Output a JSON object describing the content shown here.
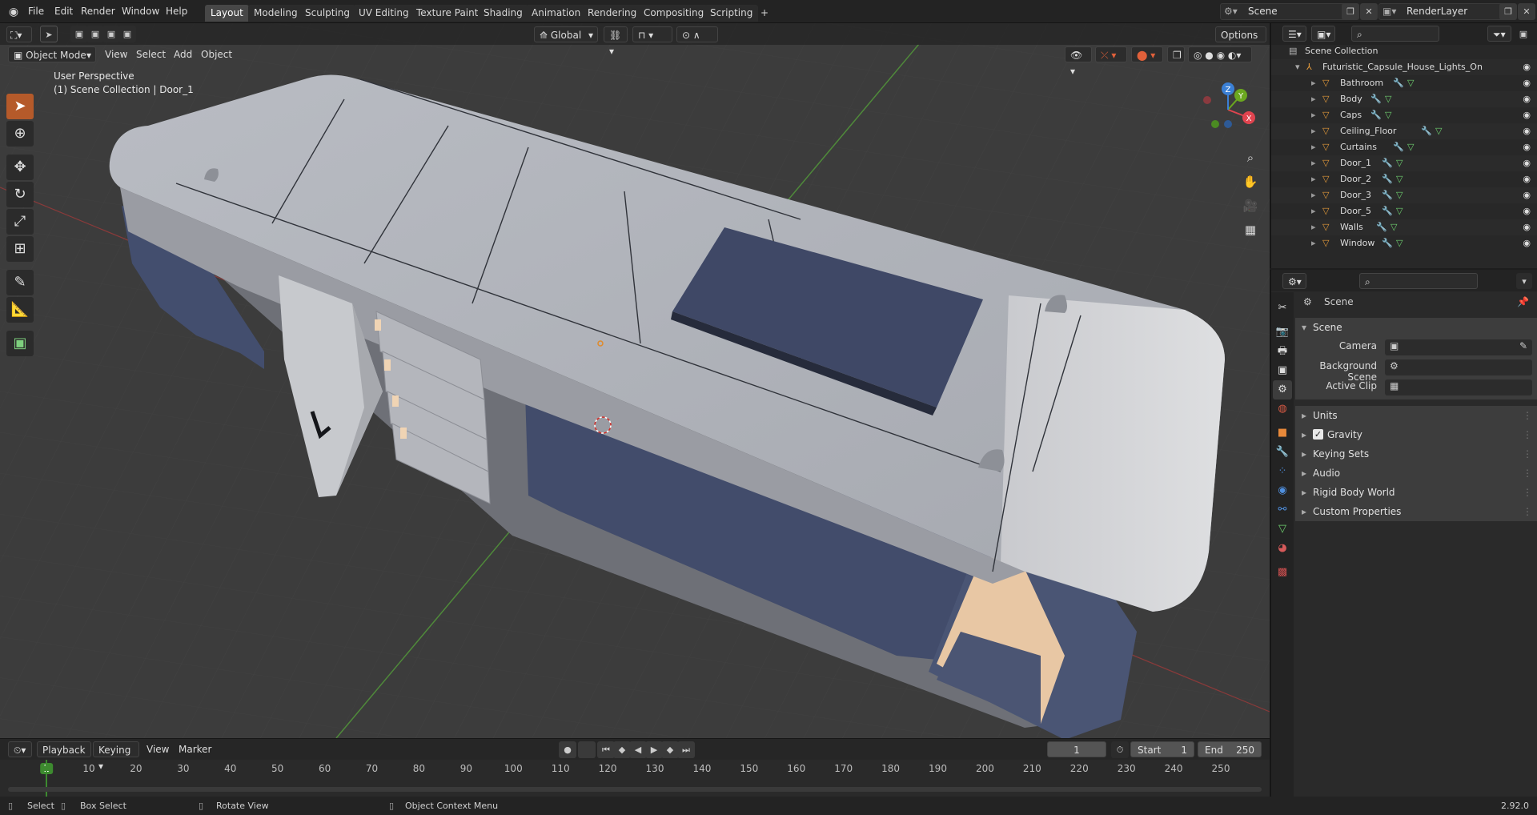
{
  "topbar": {
    "menus": [
      "File",
      "Edit",
      "Render",
      "Window",
      "Help"
    ],
    "workspaces": [
      "Layout",
      "Modeling",
      "Sculpting",
      "UV Editing",
      "Texture Paint",
      "Shading",
      "Animation",
      "Rendering",
      "Compositing",
      "Scripting"
    ],
    "active_workspace": "Layout",
    "add_tab": "+",
    "scene": "Scene",
    "render_layer": "RenderLayer"
  },
  "viewport": {
    "mode": "Object Mode",
    "menus": [
      "View",
      "Select",
      "Add",
      "Object"
    ],
    "transform_orientation": "Global",
    "options_label": "Options",
    "perspective_label": "User Perspective",
    "collection_label": "(1) Scene Collection | Door_1",
    "gizmo_axes": [
      "X",
      "Y",
      "Z"
    ]
  },
  "timeline": {
    "menus": [
      "Playback",
      "Keying",
      "View",
      "Marker"
    ],
    "current_frame": "1",
    "start_label": "Start",
    "start_value": "1",
    "end_label": "End",
    "end_value": "250",
    "ruler": [
      "1",
      "10",
      "20",
      "30",
      "40",
      "50",
      "60",
      "70",
      "80",
      "90",
      "100",
      "110",
      "120",
      "130",
      "140",
      "150",
      "160",
      "170",
      "180",
      "190",
      "200",
      "210",
      "220",
      "230",
      "240",
      "250"
    ]
  },
  "statusbar": {
    "select": "Select",
    "box_select": "Box Select",
    "rotate_view": "Rotate View",
    "context_menu": "Object Context Menu",
    "version": "2.92.0"
  },
  "outliner": {
    "root": "Scene Collection",
    "collection": "Futuristic_Capsule_House_Lights_On",
    "items": [
      "Bathroom",
      "Body",
      "Caps",
      "Ceiling_Floor",
      "Curtains",
      "Door_1",
      "Door_2",
      "Door_3",
      "Door_5",
      "Walls",
      "Window"
    ]
  },
  "properties": {
    "context": "Scene",
    "panel": "Scene",
    "camera_label": "Camera",
    "background_scene_label": "Background Scene",
    "active_clip_label": "Active Clip",
    "subpanels": [
      "Units",
      "Gravity",
      "Keying Sets",
      "Audio",
      "Rigid Body World",
      "Custom Properties"
    ]
  },
  "colors": {
    "accent_orange": "#b55a2a",
    "axis_x": "#e0444f",
    "axis_y": "#6ba71f",
    "axis_z": "#3b80d6",
    "current_frame": "#3d8a2f"
  }
}
